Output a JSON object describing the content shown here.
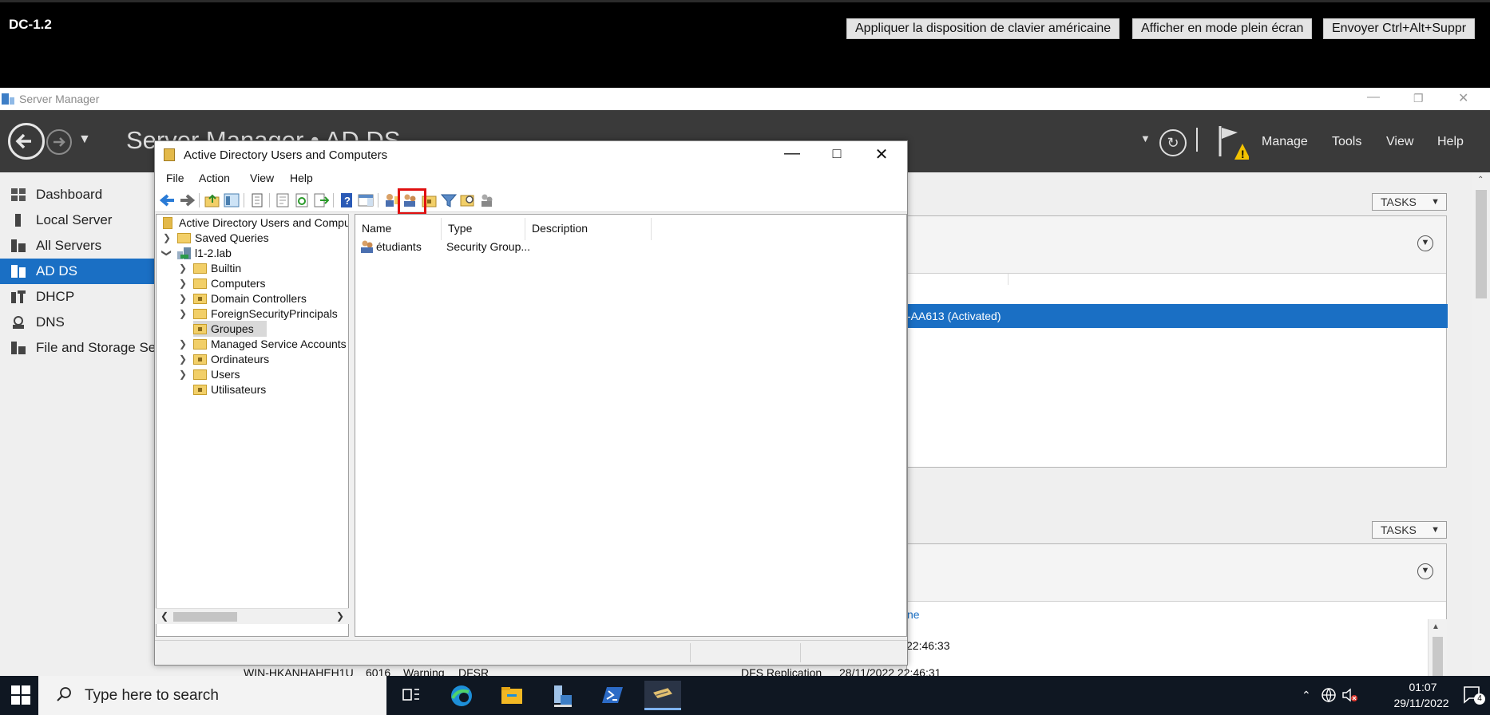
{
  "console": {
    "title": "DC-1.2",
    "buttons": [
      "Appliquer la disposition de clavier américaine",
      "Afficher en mode plein écran",
      "Envoyer Ctrl+Alt+Suppr"
    ]
  },
  "server_manager": {
    "window_title": "Server Manager",
    "breadcrumb": "Server Manager • AD DS",
    "menus": [
      "Manage",
      "Tools",
      "View",
      "Help"
    ],
    "nav": [
      "Dashboard",
      "Local Server",
      "All Servers",
      "AD DS",
      "DHCP",
      "DNS",
      "File and Storage Services"
    ],
    "selected_nav": "AD DS",
    "tasks_label": "TASKS",
    "selected_row_text": "-AA613 (Activated)",
    "link_fragment": "ne",
    "events": [
      {
        "server": "",
        "id": "",
        "severity": "",
        "source": "",
        "log": "",
        "time": "22:46:33"
      },
      {
        "server": "WIN-HKANHAHEH1U",
        "id": "6016",
        "severity": "Warning",
        "source": "DFSR",
        "log": "DFS Replication",
        "time": "28/11/2022 22:46:31"
      }
    ]
  },
  "aduc": {
    "title": "Active Directory Users and Computers",
    "menu": [
      "File",
      "Action",
      "View",
      "Help"
    ],
    "tree": {
      "root": "Active Directory Users and Computers",
      "saved_queries": "Saved Queries",
      "domain": "l1-2.lab",
      "children": [
        "Builtin",
        "Computers",
        "Domain Controllers",
        "ForeignSecurityPrincipals",
        "Groupes",
        "Managed Service Accounts",
        "Ordinateurs",
        "Users",
        "Utilisateurs"
      ],
      "selected": "Groupes"
    },
    "columns": [
      "Name",
      "Type",
      "Description"
    ],
    "rows": [
      {
        "name": "étudiants",
        "type": "Security Group...",
        "description": ""
      }
    ]
  },
  "taskbar": {
    "search_placeholder": "Type here to search",
    "time": "01:07",
    "date": "29/11/2022",
    "notification_count": "4"
  }
}
